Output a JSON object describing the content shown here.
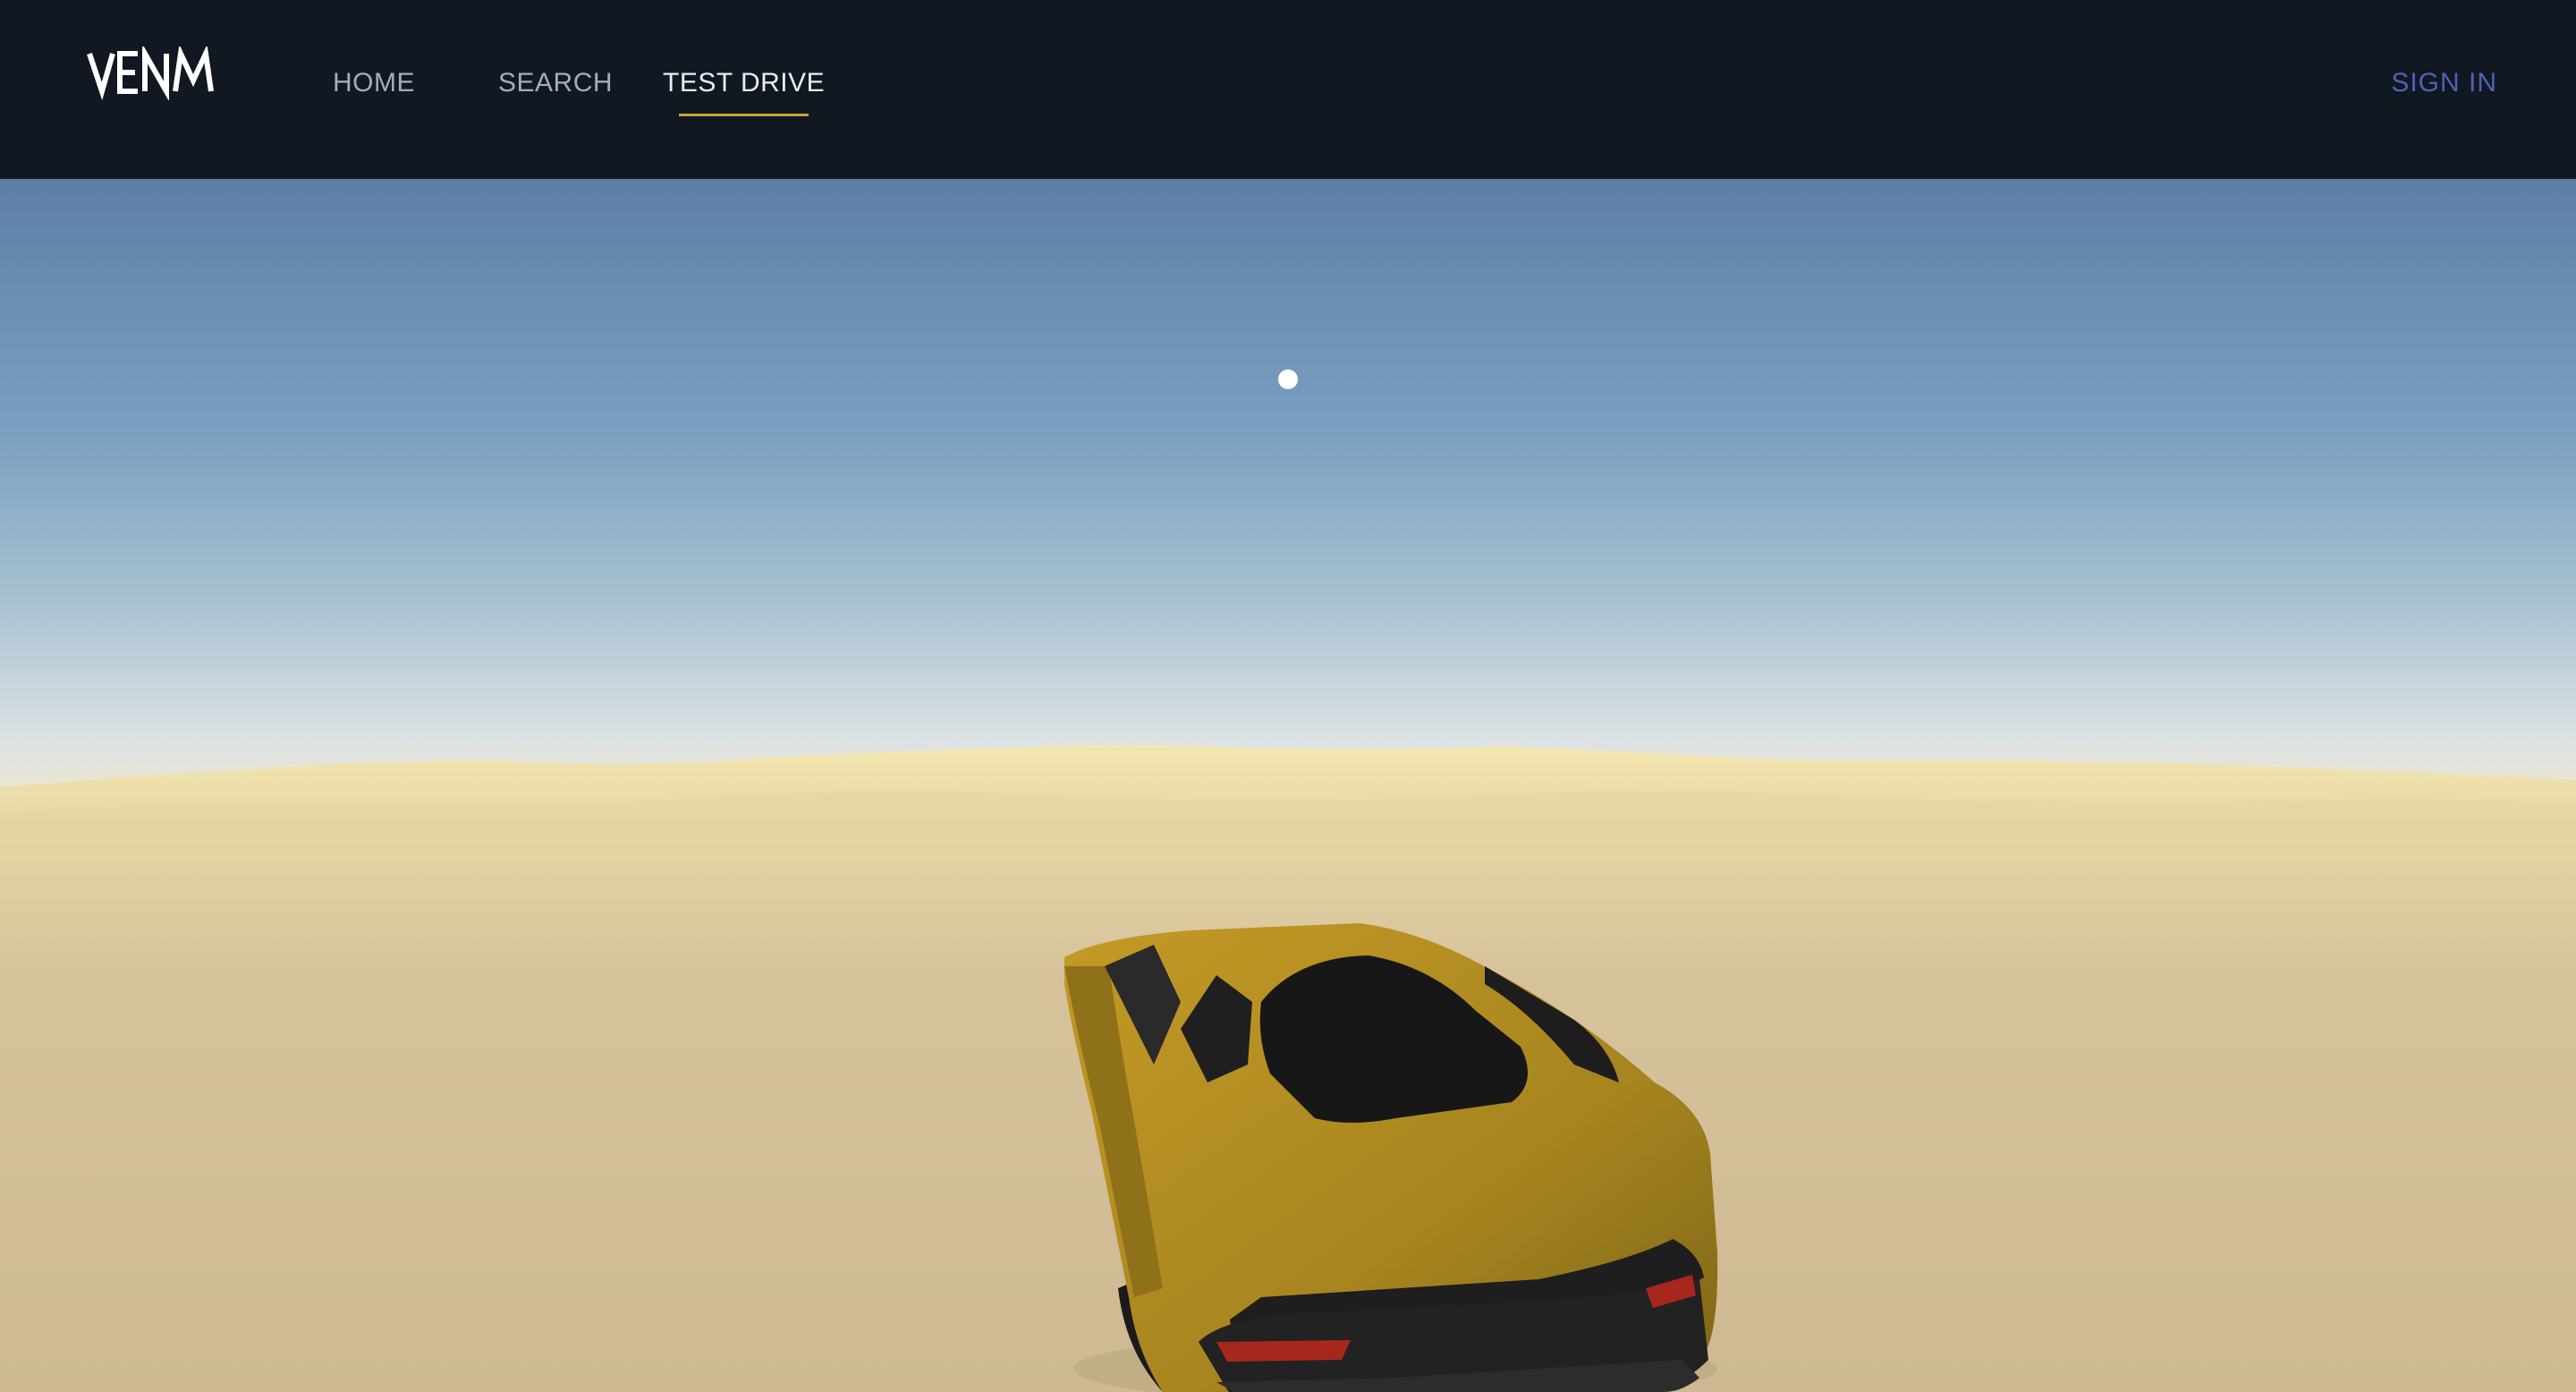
{
  "brand": {
    "logo_text": "VENM"
  },
  "nav": {
    "items": [
      {
        "label": "HOME",
        "active": false
      },
      {
        "label": "SEARCH",
        "active": false
      },
      {
        "label": "TEST DRIVE",
        "active": true
      }
    ]
  },
  "auth": {
    "sign_in_label": "SIGN IN"
  },
  "colors": {
    "navbar_bg": "#111821",
    "active_underline": "#c8a43c",
    "sign_in": "#4d63b3",
    "sky_top": "#5d7fa6",
    "sky_horizon": "#dce2e4",
    "sand": "#d2bd95",
    "car_body": "#b38e22"
  },
  "scene": {
    "name": "test-drive-3d-viewport",
    "environment": "desert",
    "vehicle": "yellow sports car (rear view)"
  }
}
